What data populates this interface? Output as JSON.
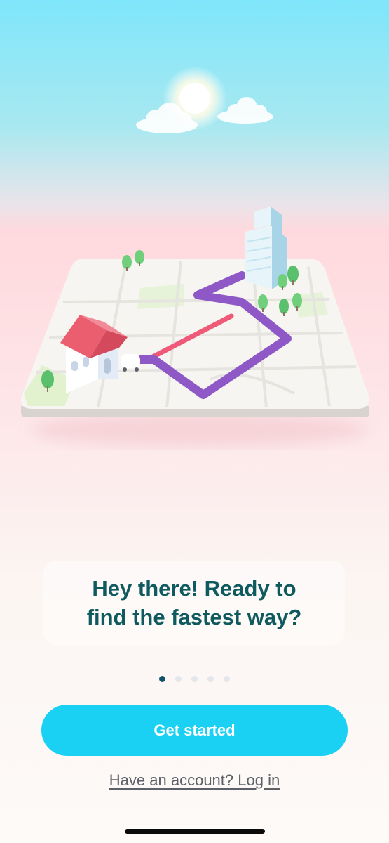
{
  "onboarding": {
    "headline_line1": "Hey there! Ready to",
    "headline_line2": "find the fastest way?",
    "pager": {
      "total": 5,
      "current": 1
    },
    "cta_label": "Get started",
    "login_link": "Have an account? Log in"
  },
  "colors": {
    "accent": "#1ad1f4",
    "headline": "#0f5a5e",
    "route": "#8e58c6",
    "route_traffic": "#ee5a78",
    "active_dot": "#12516a"
  },
  "icons": [
    "sun-icon",
    "cloud-icon",
    "house-icon",
    "car-icon",
    "building-icon",
    "tree-icon"
  ]
}
